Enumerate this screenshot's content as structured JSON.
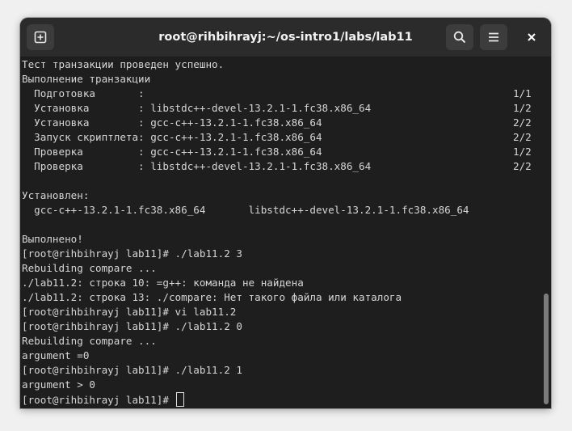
{
  "window": {
    "title": "root@rihbihrayj:~/os-intro1/labs/lab11"
  },
  "titlebar": {
    "new_tab_icon": "new-tab-icon",
    "search_icon": "search-icon",
    "menu_icon": "hamburger-menu-icon",
    "close_icon": "close-icon"
  },
  "colors": {
    "terminal_bg": "#1e1e1e",
    "terminal_fg": "#d6d6d6",
    "titlebar_bg": "#2b2b2b"
  },
  "terminal": {
    "lines": [
      {
        "text": "Тест транзакции проведен успешно.",
        "right": ""
      },
      {
        "text": "Выполнение транзакции",
        "right": ""
      },
      {
        "text": "  Подготовка       :",
        "right": "1/1"
      },
      {
        "text": "  Установка        : libstdc++-devel-13.2.1-1.fc38.x86_64",
        "right": "1/2"
      },
      {
        "text": "  Установка        : gcc-c++-13.2.1-1.fc38.x86_64",
        "right": "2/2"
      },
      {
        "text": "  Запуск скриптлета: gcc-c++-13.2.1-1.fc38.x86_64",
        "right": "2/2"
      },
      {
        "text": "  Проверка         : gcc-c++-13.2.1-1.fc38.x86_64",
        "right": "1/2"
      },
      {
        "text": "  Проверка         : libstdc++-devel-13.2.1-1.fc38.x86_64",
        "right": "2/2"
      },
      {
        "text": "",
        "right": ""
      },
      {
        "text": "Установлен:",
        "right": ""
      },
      {
        "text": "  gcc-c++-13.2.1-1.fc38.x86_64       libstdc++-devel-13.2.1-1.fc38.x86_64",
        "right": ""
      },
      {
        "text": "",
        "right": ""
      },
      {
        "text": "Выполнено!",
        "right": ""
      },
      {
        "text": "[root@rihbihrayj lab11]# ./lab11.2 3",
        "right": ""
      },
      {
        "text": "Rebuilding compare ...",
        "right": ""
      },
      {
        "text": "./lab11.2: строка 10: =g++: команда не найдена",
        "right": ""
      },
      {
        "text": "./lab11.2: строка 13: ./compare: Нет такого файла или каталога",
        "right": ""
      },
      {
        "text": "[root@rihbihrayj lab11]# vi lab11.2",
        "right": ""
      },
      {
        "text": "[root@rihbihrayj lab11]# ./lab11.2 0",
        "right": ""
      },
      {
        "text": "Rebuilding compare ...",
        "right": ""
      },
      {
        "text": "argument =0",
        "right": ""
      },
      {
        "text": "[root@rihbihrayj lab11]# ./lab11.2 1",
        "right": ""
      },
      {
        "text": "argument > 0",
        "right": ""
      }
    ],
    "prompt": "[root@rihbihrayj lab11]# "
  }
}
